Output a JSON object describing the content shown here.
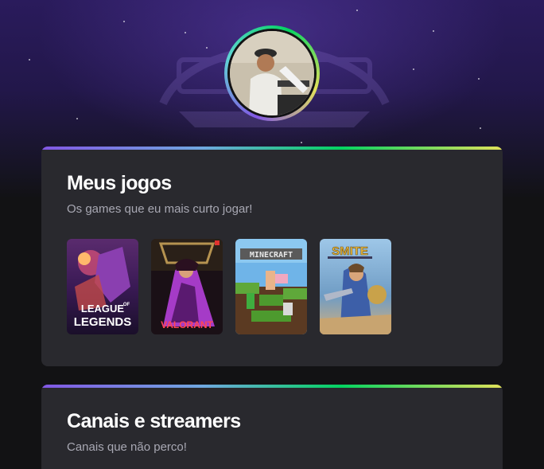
{
  "profile": {
    "avatar_alt": "Profile avatar"
  },
  "sections": [
    {
      "title": "Meus jogos",
      "subtitle": "Os games que eu mais curto jogar!",
      "games": [
        {
          "name": "League of Legends",
          "logo_text_top": "LEAGUE",
          "logo_text_of": "OF",
          "logo_text_bottom": "LEGENDS"
        },
        {
          "name": "Valorant",
          "logo_text": "VALORANT"
        },
        {
          "name": "Minecraft",
          "logo_text": "MINECRAFT"
        },
        {
          "name": "Smite",
          "logo_text": "SMITE"
        }
      ]
    },
    {
      "title": "Canais e streamers",
      "subtitle": "Canais que não perco!"
    }
  ],
  "colors": {
    "background": "#121214",
    "card": "#29292e",
    "accent_gradient": [
      "#8257e5",
      "#04d361",
      "#e1e15a"
    ]
  }
}
